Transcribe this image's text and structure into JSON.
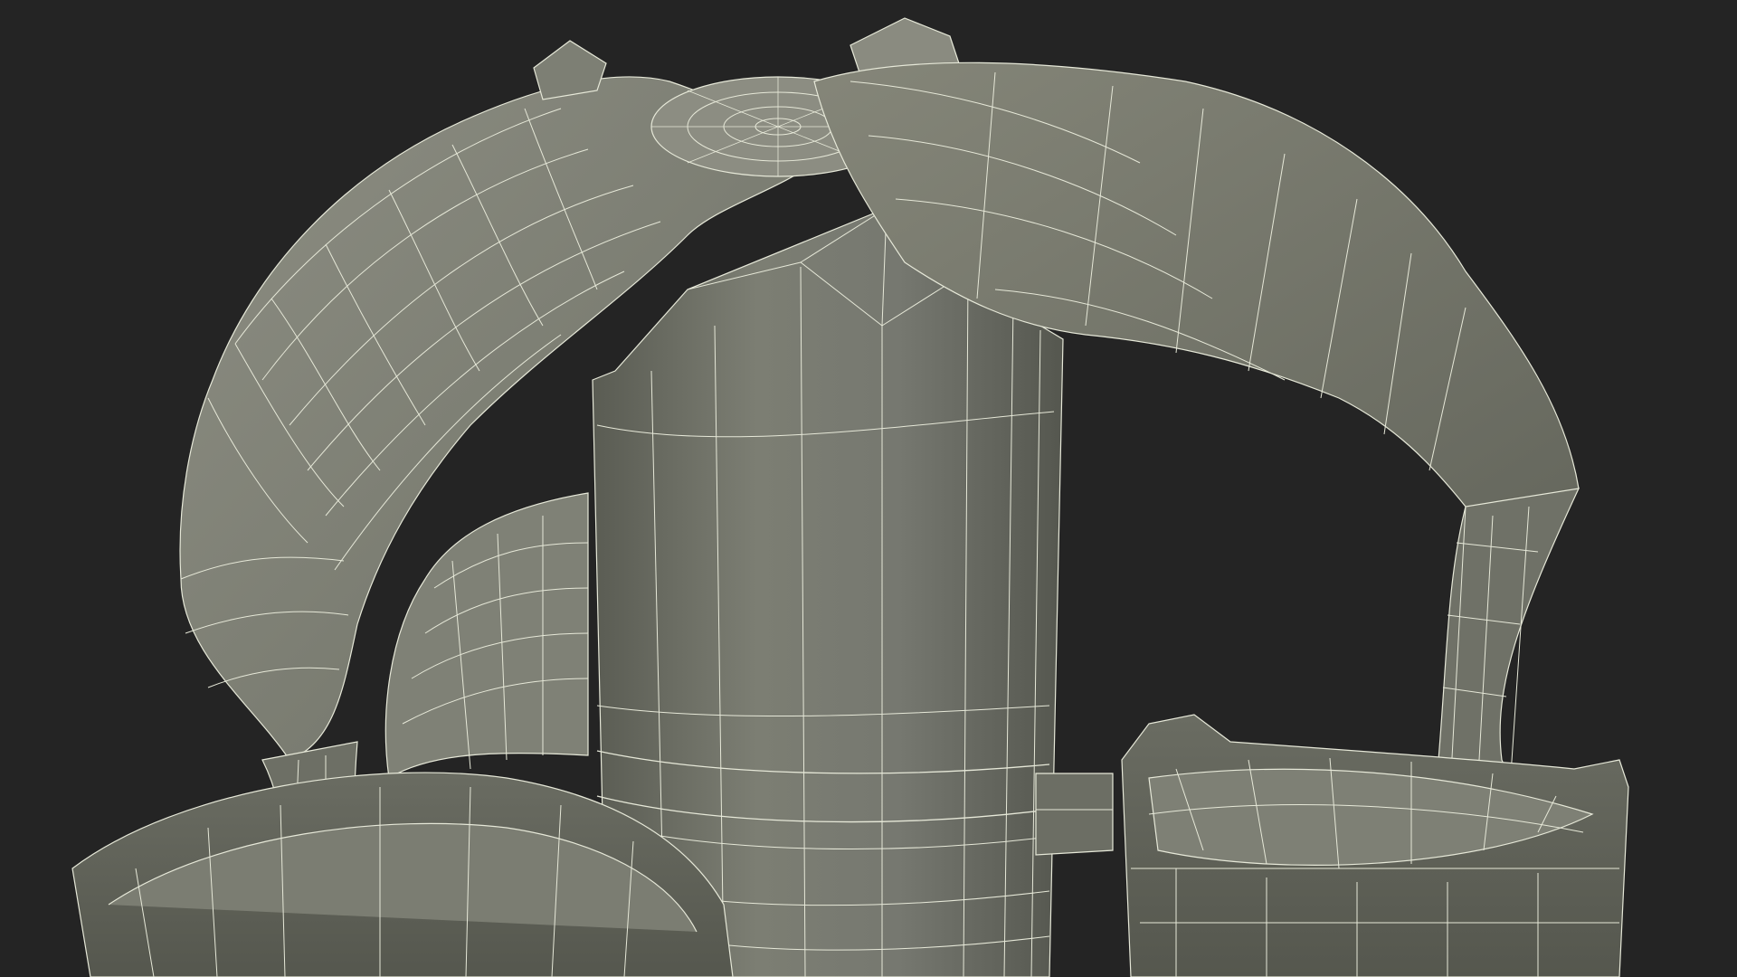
{
  "scene": {
    "subject": "wireframe-render",
    "colors": {
      "background": "#242424",
      "surface_light": "#8a8b80",
      "surface_mid": "#73756a",
      "surface_dark": "#5c5e55",
      "surface_shadow": "#4a4c44",
      "wire": "#e6e8d8"
    }
  }
}
